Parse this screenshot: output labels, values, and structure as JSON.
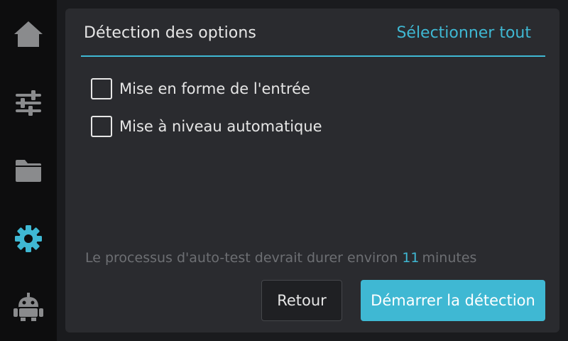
{
  "sidebar": {
    "items": [
      {
        "icon": "home-icon",
        "active": false
      },
      {
        "icon": "sliders-icon",
        "active": false
      },
      {
        "icon": "folder-icon",
        "active": false
      },
      {
        "icon": "gear-icon",
        "active": true
      },
      {
        "icon": "robot-icon",
        "active": false
      }
    ]
  },
  "panel": {
    "title": "Détection des options",
    "select_all": "Sélectionner tout",
    "options": [
      {
        "label": "Mise en forme de l'entrée",
        "checked": false
      },
      {
        "label": "Mise à niveau automatique",
        "checked": false
      }
    ],
    "info": {
      "prefix": "Le processus d'auto-test devrait durer environ",
      "value": "11",
      "suffix": "minutes"
    },
    "back_label": "Retour",
    "start_label": "Démarrer la détection"
  },
  "colors": {
    "accent": "#3fb8d3",
    "panel_bg": "#2a2b2f",
    "sidebar_bg": "#0d0d0e",
    "icon_inactive": "#8a8b8d"
  }
}
